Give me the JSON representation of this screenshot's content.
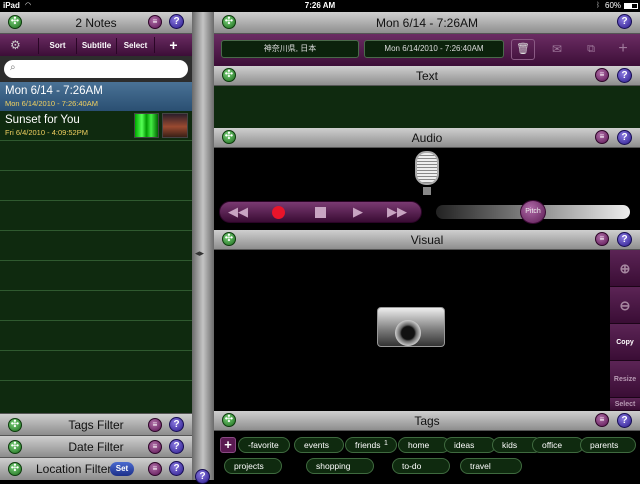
{
  "status": {
    "device": "iPad",
    "time": "7:26 AM",
    "battery": "60%"
  },
  "notes_panel": {
    "title": "2 Notes",
    "toolbar": {
      "sort": "Sort",
      "subtitle": "Subtitle",
      "select": "Select",
      "add": "+"
    },
    "search": {
      "placeholder": ""
    },
    "notes": [
      {
        "title": "Mon 6/14 - 7:26AM",
        "subtitle": "Mon 6/14/2010 - 7:26:40AM"
      },
      {
        "title": "Sunset for You",
        "subtitle": "Fri 6/4/2010 - 4:09:52PM"
      }
    ],
    "filters": {
      "tags": "Tags Filter",
      "date": "Date Filter",
      "location": "Location Filter",
      "set": "Set"
    }
  },
  "detail": {
    "title": "Mon 6/14 - 7:26AM",
    "location": "神奈川県, 日本",
    "datetime": "Mon 6/14/2010 - 7:26:40AM",
    "sections": {
      "text": "Text",
      "audio": "Audio",
      "visual": "Visual",
      "tags": "Tags"
    },
    "pitch": "Pitch",
    "visual_tools": {
      "copy": "Copy",
      "resize": "Resize",
      "select": "Select"
    },
    "tags": [
      "-favorite",
      "events",
      "friends",
      "home",
      "ideas",
      "kids",
      "office",
      "parents",
      "projects",
      "shopping",
      "to-do",
      "travel"
    ],
    "friends_count": "1"
  },
  "icons": {
    "help": "?",
    "move": "✣"
  },
  "colors": {
    "accent_purple": "#5a1a52",
    "note_green": "#0f2a0f",
    "selected_blue": "#355c80"
  }
}
